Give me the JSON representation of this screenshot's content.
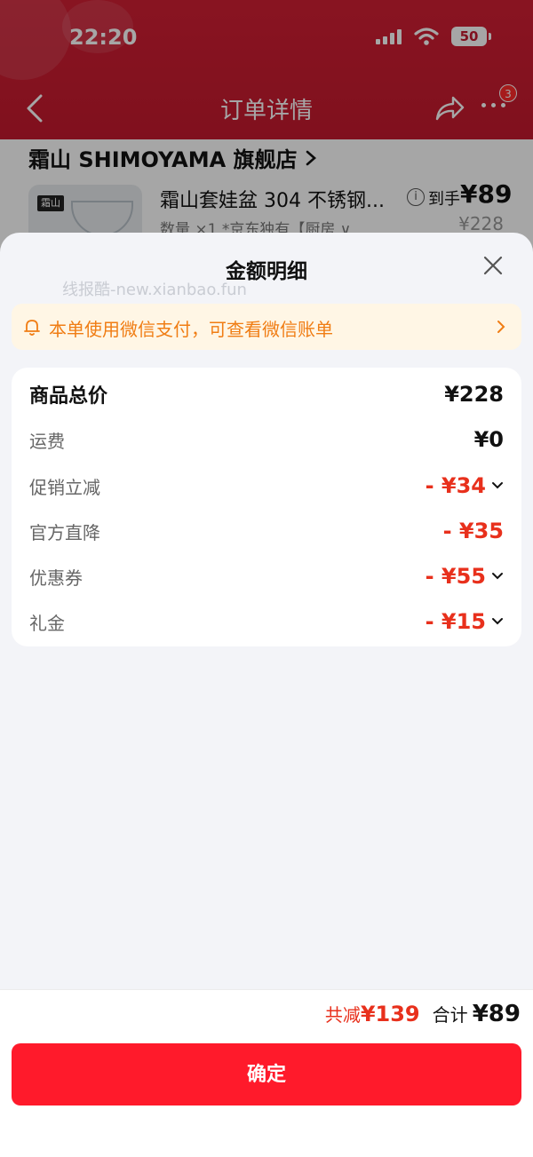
{
  "status_bar": {
    "time": "22:20",
    "battery": "50"
  },
  "nav": {
    "title": "订单详情",
    "more_badge": "3"
  },
  "store": {
    "name": "霜山 SHIMOYAMA 旗舰店"
  },
  "product": {
    "thumb_logo": "霜山",
    "title": "霜山套娃盆 304 不锈钢...",
    "subtitle": "数量 ×1  *京东独有【厨房 ∨",
    "price_label": "到手",
    "price": "¥89",
    "original_price": "¥228"
  },
  "sheet": {
    "title": "金额明细",
    "watermark": "线报酷-new.xianbao.fun",
    "notice": "本单使用微信支付，可查看微信账单",
    "rows": [
      {
        "label": "商品总价",
        "value": "¥228"
      },
      {
        "label": "运费",
        "value": "¥0"
      },
      {
        "label": "促销立减",
        "value": "- ¥34"
      },
      {
        "label": "官方直降",
        "value": "- ¥35"
      },
      {
        "label": "优惠券",
        "value": "- ¥55"
      },
      {
        "label": "礼金",
        "value": "- ¥15"
      }
    ],
    "footer": {
      "discount_label": "共减",
      "discount_value": "¥139",
      "total_label": "合计",
      "total_value": "¥89",
      "confirm": "确定"
    }
  },
  "colors": {
    "accent_red": "#e8301c",
    "button_red": "#ff1a2b",
    "notice_orange": "#f07d14",
    "header_red": "#c51a2e"
  },
  "icons": [
    "back-arrow-icon",
    "share-icon",
    "more-icon",
    "chevron-right-icon",
    "info-icon",
    "close-icon",
    "bell-icon",
    "chevron-down-icon",
    "wifi-icon",
    "signal-icon"
  ]
}
